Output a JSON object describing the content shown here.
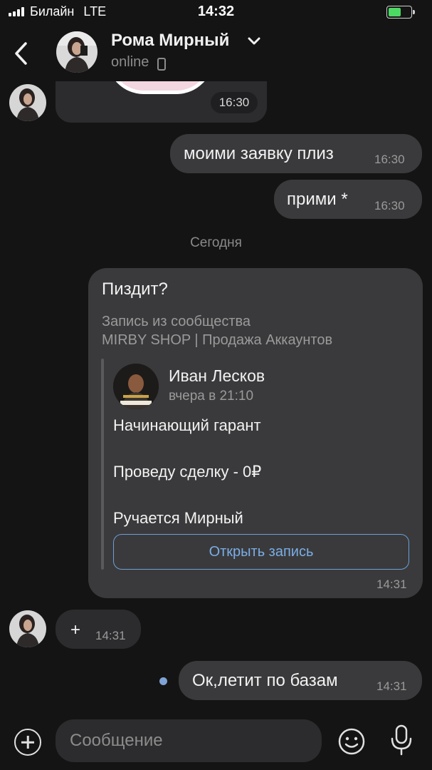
{
  "status_bar": {
    "carrier": "Билайн",
    "network": "LTE",
    "time": "14:32",
    "battery_level": 0.55,
    "battery_color": "#4cd964"
  },
  "header": {
    "back_icon": "chevron-left-icon",
    "contact_name": "Рома Мирный",
    "presence": "online",
    "presence_icon": "mobile-phone-icon",
    "menu_icon": "chevron-down-icon"
  },
  "messages": {
    "m0": {
      "direction": "incoming",
      "time": "16:30",
      "content": "image"
    },
    "m1": {
      "direction": "outgoing",
      "text": "моими заявку плиз",
      "time": "16:30"
    },
    "m2": {
      "direction": "outgoing",
      "text": "прими *",
      "time": "16:30"
    },
    "date_separator": "Сегодня",
    "m3": {
      "direction": "outgoing",
      "text": "Пиздит?",
      "source_label": "Запись из сообщества",
      "source_name": "MIRBY SHOP | Продажа Аккаунтов",
      "post": {
        "author": "Иван Лесков",
        "date": "вчера в 21:10",
        "line1": "Начинающий гарант",
        "line2": "Проведу сделку - 0₽",
        "line3": "Ручается Мирный",
        "button": "Открыть запись"
      },
      "time": "14:31"
    },
    "m4": {
      "direction": "incoming",
      "text": "+",
      "time": "14:31"
    },
    "m5": {
      "direction": "outgoing",
      "text": "Ок,летит по базам",
      "time": "14:31",
      "status": "unread"
    }
  },
  "input_bar": {
    "attach_icon": "plus-circle-icon",
    "placeholder": "Сообщение",
    "emoji_icon": "smiley-icon",
    "mic_icon": "microphone-icon"
  },
  "colors": {
    "background": "#141414",
    "incoming_bubble": "#2c2c2e",
    "outgoing_bubble": "#3a3a3c",
    "link_blue": "#7aaee6"
  }
}
